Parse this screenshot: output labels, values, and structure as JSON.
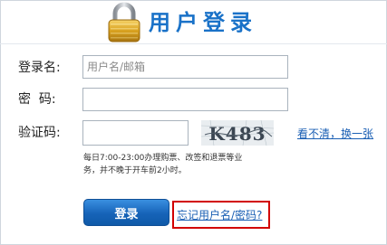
{
  "header": {
    "title": "用户登录",
    "icon": "padlock-icon"
  },
  "form": {
    "username_label": "登录名:",
    "username_placeholder": "用户名/邮箱",
    "username_value": "",
    "password_label": "密  码:",
    "password_value": "",
    "captcha_label": "验证码:",
    "captcha_value": "",
    "captcha_text": "K483",
    "refresh_link": "看不清，换一张",
    "hint": "每日7:00-23:00办理购票、改签和退票等业务，并不晚于开车前2小时。",
    "login_button": "登录",
    "forgot_link": "忘记用户名/密码?"
  },
  "colors": {
    "title": "#1a72c8",
    "link": "#1a5fb4",
    "button": "#1663b8",
    "highlight": "#d20000"
  }
}
